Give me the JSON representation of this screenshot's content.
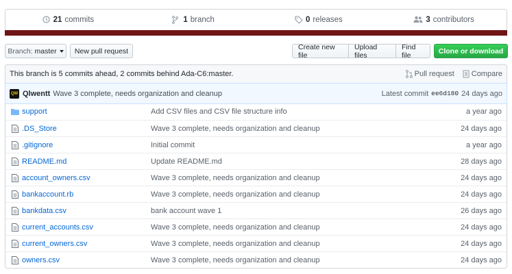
{
  "summary": {
    "commits_count": "21",
    "commits_label": "commits",
    "branch_count": "1",
    "branch_label": "branch",
    "releases_count": "0",
    "releases_label": "releases",
    "contributors_count": "3",
    "contributors_label": "contributors",
    "language_bar_color": "#701516"
  },
  "toolbar": {
    "branch_prefix": "Branch:",
    "branch_name": "master",
    "new_pull_request": "New pull request",
    "create_new_file": "Create new file",
    "upload_files": "Upload files",
    "find_file": "Find file",
    "clone_or_download": "Clone or download"
  },
  "branch_info": {
    "text": "This branch is 5 commits ahead, 2 commits behind Ada-C6:master.",
    "pull_request": "Pull request",
    "compare": "Compare"
  },
  "latest_commit": {
    "avatar_text": "QW",
    "author": "Qlwentt",
    "message": "Wave 3 complete, needs organization and cleanup",
    "label": "Latest commit",
    "sha": "ee6d180",
    "age": "24 days ago"
  },
  "files": [
    {
      "type": "folder",
      "name": "support",
      "message": "Add CSV files and CSV file structure info",
      "age": "a year ago"
    },
    {
      "type": "file",
      "name": ".DS_Store",
      "message": "Wave 3 complete, needs organization and cleanup",
      "age": "24 days ago"
    },
    {
      "type": "file",
      "name": ".gitignore",
      "message": "Initial commit",
      "age": "a year ago"
    },
    {
      "type": "file",
      "name": "README.md",
      "message": "Update README.md",
      "age": "28 days ago"
    },
    {
      "type": "file",
      "name": "account_owners.csv",
      "message": "Wave 3 complete, needs organization and cleanup",
      "age": "24 days ago"
    },
    {
      "type": "file",
      "name": "bankaccount.rb",
      "message": "Wave 3 complete, needs organization and cleanup",
      "age": "24 days ago"
    },
    {
      "type": "file",
      "name": "bankdata.csv",
      "message": "bank account wave 1",
      "age": "26 days ago"
    },
    {
      "type": "file",
      "name": "current_accounts.csv",
      "message": "Wave 3 complete, needs organization and cleanup",
      "age": "24 days ago"
    },
    {
      "type": "file",
      "name": "current_owners.csv",
      "message": "Wave 3 complete, needs organization and cleanup",
      "age": "24 days ago"
    },
    {
      "type": "file",
      "name": "owners.csv",
      "message": "Wave 3 complete, needs organization and cleanup",
      "age": "24 days ago"
    }
  ]
}
